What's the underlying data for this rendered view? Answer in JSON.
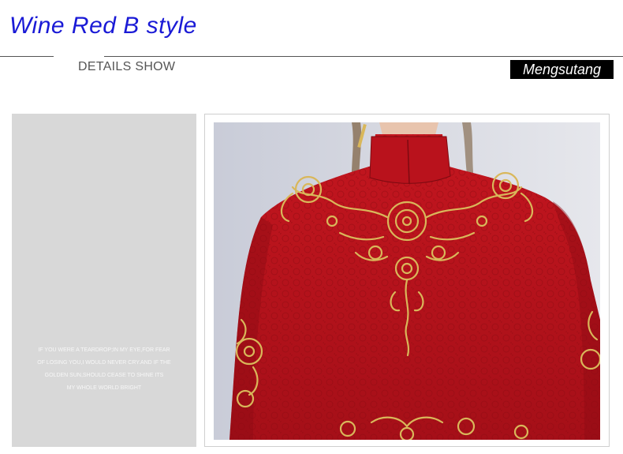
{
  "title": "Wine Red B style",
  "section_label": "DETAILS SHOW",
  "brand": "Mengsutang",
  "poem": [
    "IF YOU WERE A TEARDROP;IN MY EYE,FOR FEAR",
    "OF LOSING YOU,I WOULD NEVER CRY.AND IF THE",
    "GOLDEN SUN,SHOULD CEASE TO SHINE ITS",
    "MY WHOLE WORLD BRIGHT"
  ],
  "colors": {
    "title": "#1a1ad6",
    "dress": "#b5121b",
    "embroidery": "#d9b75a",
    "panel": "#d8d8d8"
  }
}
